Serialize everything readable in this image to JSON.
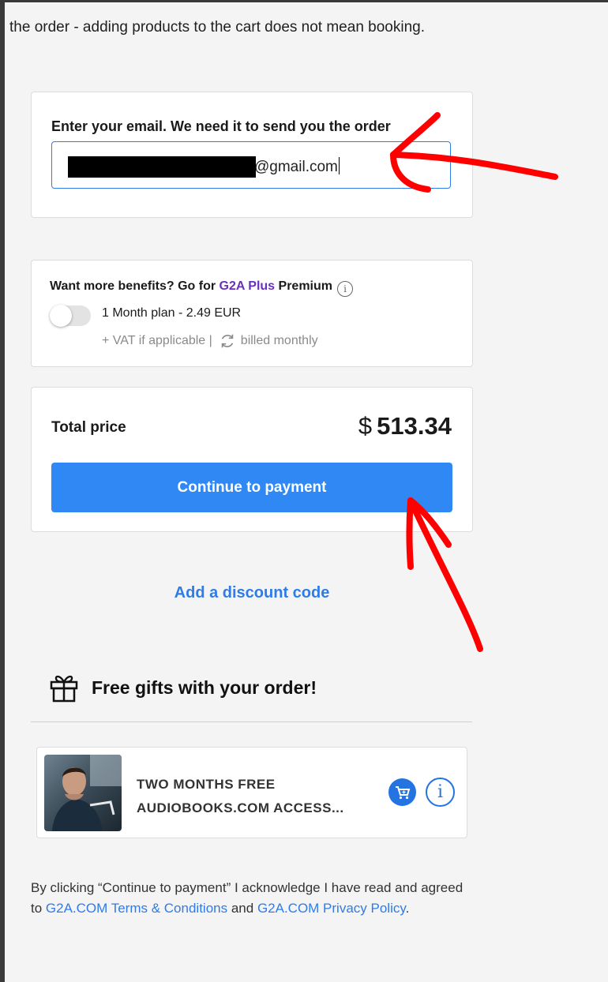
{
  "intro_text": "the order - adding products to the cart does not mean booking.",
  "email": {
    "label": "Enter your email. We need it to send you the order",
    "domain_visible": "@gmail.com"
  },
  "plus": {
    "title_prefix": "Want more benefits? Go for ",
    "brand": "G2A Plus",
    "title_suffix": " Premium",
    "info_icon": "i",
    "plan": "1 Month plan - 2.49 EUR",
    "vat": "+ VAT if applicable |",
    "billing": "billed monthly",
    "toggle_on": false
  },
  "total": {
    "label": "Total price",
    "currency": "$",
    "amount": "513.34",
    "button": "Continue to payment"
  },
  "discount_link": "Add a discount code",
  "gifts": {
    "heading": "Free gifts with your order!",
    "item": {
      "line1": "TWO MONTHS FREE",
      "line2": "AUDIOBOOKS.COM ACCESS...",
      "info": "i"
    }
  },
  "legal": {
    "prefix": "By clicking “Continue to payment” I acknowledge I have read and agreed to ",
    "terms_link": "G2A.COM Terms & Conditions",
    "middle": " and ",
    "privacy_link": "G2A.COM Privacy Policy",
    "suffix": "."
  },
  "colors": {
    "accent": "#3088f4",
    "link": "#2f7ce8",
    "brand_purple": "#6b2fbf",
    "annotation": "#ff0000"
  }
}
